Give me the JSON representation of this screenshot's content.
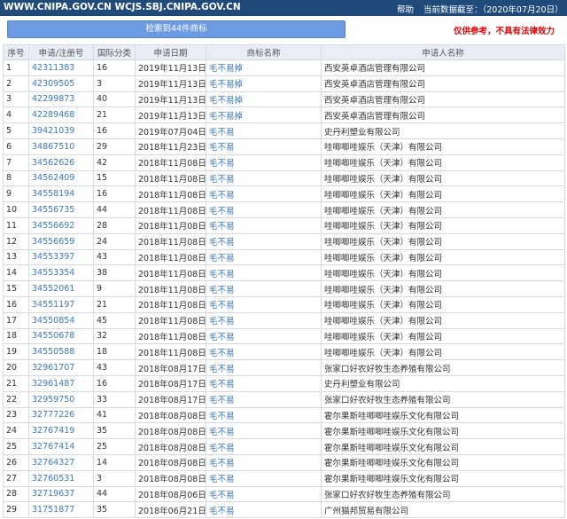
{
  "topbar": {
    "site": "WWW.CNIPA.GOV.CN WCJS.SBJ.CNIPA.GOV.CN",
    "help": "帮助",
    "date_label": "当前数据截至：（2020年07月20日）"
  },
  "search": {
    "button_label": "检索到44件商标"
  },
  "disclaimer": "仅供参考，不具有法律效力",
  "table": {
    "headers": [
      "序号",
      "申请/注册号",
      "国际分类",
      "申请日期",
      "商标名称",
      "申请人名称"
    ],
    "rows": [
      [
        "1",
        "42311383",
        "16",
        "2019年11月13日",
        "毛不易掉",
        "西安英卓酒店管理有限公司"
      ],
      [
        "2",
        "42309505",
        "3",
        "2019年11月13日",
        "毛不易掉",
        "西安英卓酒店管理有限公司"
      ],
      [
        "3",
        "42299873",
        "40",
        "2019年11月13日",
        "毛不易掉",
        "西安英卓酒店管理有限公司"
      ],
      [
        "4",
        "42289468",
        "21",
        "2019年11月13日",
        "毛不易掉",
        "西安英卓酒店管理有限公司"
      ],
      [
        "5",
        "39421039",
        "16",
        "2019年07月04日",
        "毛不易",
        "史丹利塑业有限公司"
      ],
      [
        "6",
        "34867510",
        "29",
        "2018年11月23日",
        "毛不易",
        "哇唧唧哇娱乐（天津）有限公司"
      ],
      [
        "7",
        "34562626",
        "42",
        "2018年11月08日",
        "毛不易",
        "哇唧唧哇娱乐（天津）有限公司"
      ],
      [
        "8",
        "34562409",
        "15",
        "2018年11月08日",
        "毛不易",
        "哇唧唧哇娱乐（天津）有限公司"
      ],
      [
        "9",
        "34558194",
        "16",
        "2018年11月08日",
        "毛不易",
        "哇唧唧哇娱乐（天津）有限公司"
      ],
      [
        "10",
        "34556735",
        "44",
        "2018年11月08日",
        "毛不易",
        "哇唧唧哇娱乐（天津）有限公司"
      ],
      [
        "11",
        "34556692",
        "28",
        "2018年11月08日",
        "毛不易",
        "哇唧唧哇娱乐（天津）有限公司"
      ],
      [
        "12",
        "34556659",
        "24",
        "2018年11月08日",
        "毛不易",
        "哇唧唧哇娱乐（天津）有限公司"
      ],
      [
        "13",
        "34553397",
        "43",
        "2018年11月08日",
        "毛不易",
        "哇唧唧哇娱乐（天津）有限公司"
      ],
      [
        "14",
        "34553354",
        "38",
        "2018年11月08日",
        "毛不易",
        "哇唧唧哇娱乐（天津）有限公司"
      ],
      [
        "15",
        "34552061",
        "9",
        "2018年11月08日",
        "毛不易",
        "哇唧唧哇娱乐（天津）有限公司"
      ],
      [
        "16",
        "34551197",
        "21",
        "2018年11月08日",
        "毛不易",
        "哇唧唧哇娱乐（天津）有限公司"
      ],
      [
        "17",
        "34550854",
        "45",
        "2018年11月08日",
        "毛不易",
        "哇唧唧哇娱乐（天津）有限公司"
      ],
      [
        "18",
        "34550678",
        "32",
        "2018年11月08日",
        "毛不易",
        "哇唧唧哇娱乐（天津）有限公司"
      ],
      [
        "19",
        "34550588",
        "18",
        "2018年11月08日",
        "毛不易",
        "哇唧唧哇娱乐（天津）有限公司"
      ],
      [
        "20",
        "32961707",
        "43",
        "2018年08月17日",
        "毛不易",
        "张家口好农好牧生态养殖有限公司"
      ],
      [
        "21",
        "32961487",
        "16",
        "2018年08月17日",
        "毛不易",
        "史丹利塑业有限公司"
      ],
      [
        "22",
        "32959750",
        "33",
        "2018年08月17日",
        "毛不易",
        "张家口好农好牧生态养殖有限公司"
      ],
      [
        "23",
        "32777226",
        "41",
        "2018年08月08日",
        "毛不易",
        "霍尔果斯哇唧唧哇娱乐文化有限公司"
      ],
      [
        "24",
        "32767419",
        "35",
        "2018年08月08日",
        "毛不易",
        "霍尔果斯哇唧唧哇娱乐文化有限公司"
      ],
      [
        "25",
        "32767414",
        "25",
        "2018年08月08日",
        "毛不易",
        "霍尔果斯哇唧唧哇娱乐文化有限公司"
      ],
      [
        "26",
        "32764327",
        "14",
        "2018年08月08日",
        "毛不易",
        "霍尔果斯哇唧唧哇娱乐文化有限公司"
      ],
      [
        "27",
        "32760531",
        "3",
        "2018年08月08日",
        "毛不易",
        "霍尔果斯哇唧唧哇娱乐文化有限公司"
      ],
      [
        "28",
        "32719637",
        "44",
        "2018年08月06日",
        "毛不易",
        "张家口好农好牧生态养殖有限公司"
      ],
      [
        "29",
        "31751877",
        "35",
        "2018年06月21日",
        "毛不易",
        "广州猫邦贸易有限公司"
      ]
    ]
  }
}
